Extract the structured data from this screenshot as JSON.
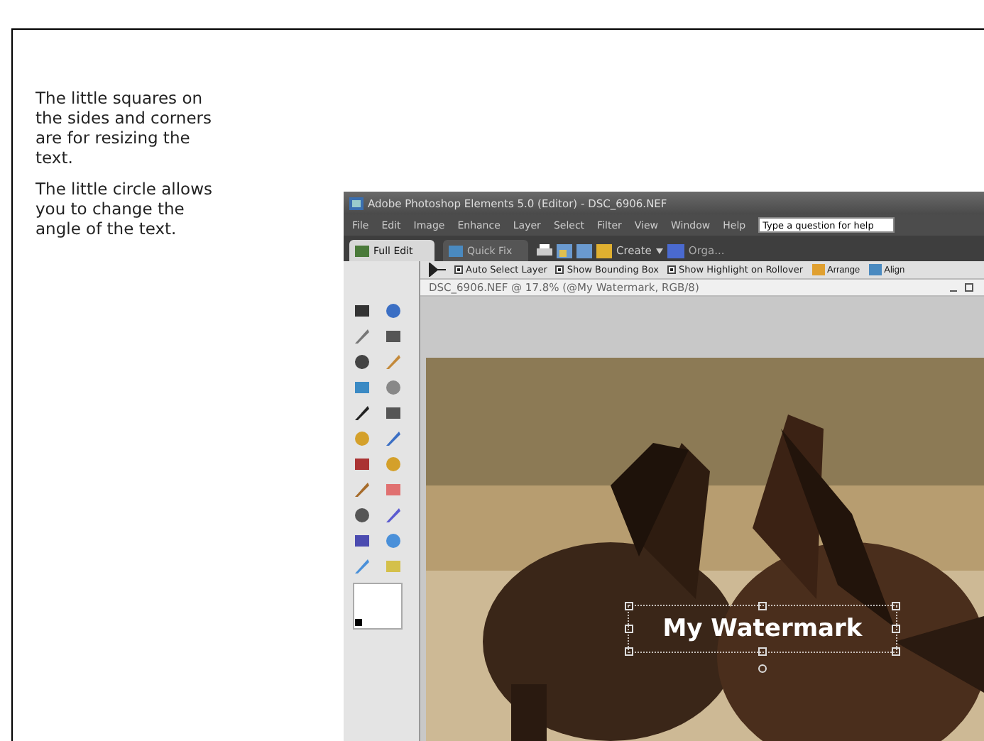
{
  "instructions": [
    {
      "text": "The little squares on the sides and corners are for resizing the text."
    },
    {
      "text": "The little circle allows you to change the angle of the text."
    }
  ],
  "editor": {
    "title": "Adobe Photoshop Elements 5.0 (Editor) - DSC_6906.NEF",
    "menu": [
      "File",
      "Edit",
      "Image",
      "Enhance",
      "Layer",
      "Select",
      "Filter",
      "View",
      "Window",
      "Help"
    ],
    "help_field": {
      "placeholder": "Type a question for help"
    },
    "modes": [
      {
        "label": "Full Edit",
        "selected": true
      },
      {
        "label": "Quick Fix",
        "selected": false
      }
    ],
    "create_menu": "Create",
    "organizer": "Orga...",
    "options": [
      {
        "label": "Auto Select Layer",
        "checked": true
      },
      {
        "label": "Show Bounding Box",
        "checked": true
      },
      {
        "label": "Show Highlight on Rollover",
        "checked": true
      }
    ],
    "option_menus": [
      "Arrange",
      "Align"
    ],
    "document": {
      "title": "DSC_6906.NEF @ 17.8% (@My Watermark, RGB/8)",
      "text_layer": "My Watermark"
    }
  }
}
